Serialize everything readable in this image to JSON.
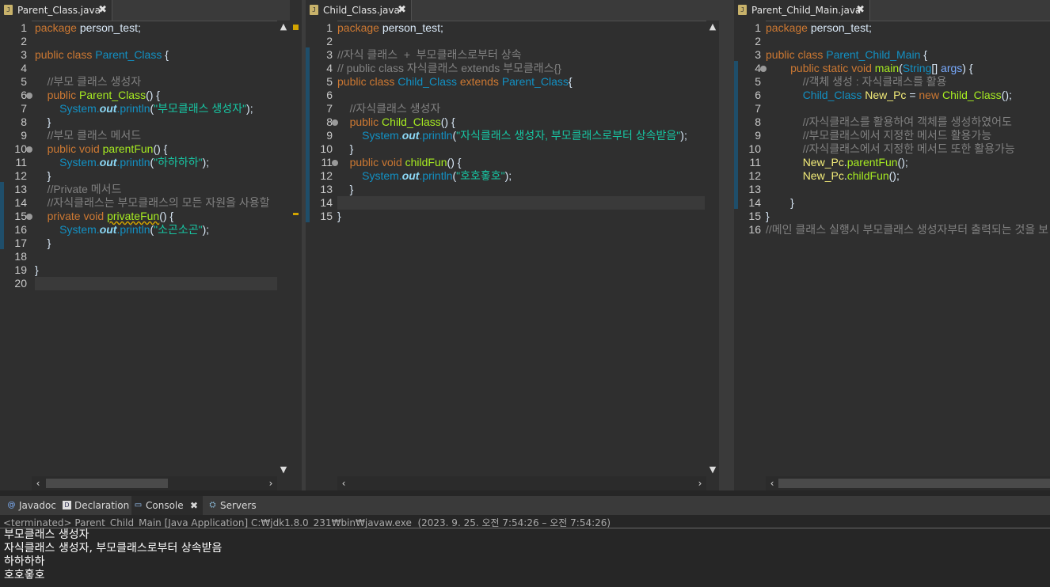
{
  "editors": [
    {
      "tab_label": "Parent_Class.java",
      "lines": [
        {
          "num": "1",
          "html": "<span class='kw'>package</span> <span class='pl'>person_test;</span>"
        },
        {
          "num": "2",
          "html": ""
        },
        {
          "num": "3",
          "html": "<span class='kw'>public</span> <span class='kw'>class</span> <span class='cls'>Parent_Class</span> <span class='pl'>{</span>"
        },
        {
          "num": "4",
          "html": ""
        },
        {
          "num": "5",
          "html": "    <span class='cmt'>//부모 클래스 생성자</span>"
        },
        {
          "num": "6",
          "html": "    <span class='kw'>public</span> <span class='mth'>Parent_Class</span><span class='pl'>() {</span>",
          "fold": true
        },
        {
          "num": "7",
          "html": "        <span class='cls'>System.</span><span class='fld'>out</span><span class='cls'>.println</span><span class='pl'>(</span><span class='str'>\"부모클래스 생성자\"</span><span class='pl'>);</span>"
        },
        {
          "num": "8",
          "html": "    <span class='pl'>}</span>"
        },
        {
          "num": "9",
          "html": "    <span class='cmt'>//부모 클래스 메서드</span>"
        },
        {
          "num": "10",
          "html": "    <span class='kw'>public</span> <span class='kw'>void</span> <span class='mth'>parentFun</span><span class='pl'>() {</span>",
          "fold": true
        },
        {
          "num": "11",
          "html": "        <span class='cls'>System.</span><span class='fld'>out</span><span class='cls'>.println</span><span class='pl'>(</span><span class='str'>\"하하하하\"</span><span class='pl'>);</span>"
        },
        {
          "num": "12",
          "html": "    <span class='pl'>}</span>"
        },
        {
          "num": "13",
          "html": "    <span class='cmt'>//Private 메서드</span>"
        },
        {
          "num": "14",
          "html": "    <span class='cmt'>//자식클래스는 부모클래스의 모든 자원을 사용할</span>"
        },
        {
          "num": "15",
          "html": "    <span class='kw'>private</span> <span class='kw'>void</span> <span class='mth' style='text-decoration:underline wavy #d2a400;'>privateFun</span><span class='pl'>() {</span>",
          "fold": true
        },
        {
          "num": "16",
          "html": "        <span class='cls'>System.</span><span class='fld'>out</span><span class='cls'>.println</span><span class='pl'>(</span><span class='str'>\"소곤소곤\"</span><span class='pl'>);</span>"
        },
        {
          "num": "17",
          "html": "    <span class='pl'>}</span>"
        },
        {
          "num": "18",
          "html": ""
        },
        {
          "num": "19",
          "html": "<span class='pl'>}</span>"
        },
        {
          "num": "20",
          "html": ""
        }
      ]
    },
    {
      "tab_label": "Child_Class.java",
      "lines": [
        {
          "num": "1",
          "html": "<span class='kw'>package</span> <span class='pl'>person_test;</span>"
        },
        {
          "num": "2",
          "html": ""
        },
        {
          "num": "3",
          "html": "<span class='cmt'>//자식 클래스  +  부모클래스로부터 상속</span>"
        },
        {
          "num": "4",
          "html": "<span class='cmt'>// public class 자식클래스 extends 부모클래스{}</span>"
        },
        {
          "num": "5",
          "html": "<span class='kw'>public</span> <span class='kw'>class</span> <span class='cls'>Child_Class</span> <span class='kw'>extends</span> <span class='cls'>Parent_Class</span><span class='pl'>{</span>"
        },
        {
          "num": "6",
          "html": ""
        },
        {
          "num": "7",
          "html": "    <span class='cmt'>//자식클래스 생성자</span>"
        },
        {
          "num": "8",
          "html": "    <span class='kw'>public</span> <span class='mth'>Child_Class</span><span class='pl'>() {</span>",
          "fold": true
        },
        {
          "num": "9",
          "html": "        <span class='cls'>System.</span><span class='fld'>out</span><span class='cls'>.println</span><span class='pl'>(</span><span class='str'>\"자식클래스 생성자, 부모클래스로부터 상속받음\"</span><span class='pl'>);</span>"
        },
        {
          "num": "10",
          "html": "    <span class='pl'>}</span>"
        },
        {
          "num": "11",
          "html": "    <span class='kw'>public</span> <span class='kw'>void</span> <span class='mth'>childFun</span><span class='pl'>() {</span>",
          "fold": true
        },
        {
          "num": "12",
          "html": "        <span class='cls'>System.</span><span class='fld'>out</span><span class='cls'>.println</span><span class='pl'>(</span><span class='str'>\"호호홓호\"</span><span class='pl'>);</span>"
        },
        {
          "num": "13",
          "html": "    <span class='pl'>}</span>"
        },
        {
          "num": "14",
          "html": ""
        },
        {
          "num": "15",
          "html": "<span class='pl'>}</span>"
        }
      ]
    },
    {
      "tab_label": "Parent_Child_Main.java",
      "lines": [
        {
          "num": "1",
          "html": "<span class='kw'>package</span> <span class='pl'>person_test;</span>"
        },
        {
          "num": "2",
          "html": ""
        },
        {
          "num": "3",
          "html": "<span class='kw'>public</span> <span class='kw'>class</span> <span class='cls'>Parent_Child_Main</span> <span class='pl'>{</span>"
        },
        {
          "num": "4",
          "html": "        <span class='kw'>public</span> <span class='kw'>static</span> <span class='kw'>void</span> <span class='mth'>main</span><span class='pl'>(</span><span class='cls'>String</span><span class='pl'>[]</span> <span class='prm'>args</span><span class='pl'>) {</span>",
          "fold": true
        },
        {
          "num": "5",
          "html": "            <span class='cmt'>//객체 생성 : 자식클래스를 활용</span>"
        },
        {
          "num": "6",
          "html": "            <span class='cls'>Child_Class</span> <span class='var'>New_Pc</span> <span class='pl'>=</span> <span class='kw'>new</span> <span class='mth'>Child_Class</span><span class='pl'>();</span>"
        },
        {
          "num": "7",
          "html": ""
        },
        {
          "num": "8",
          "html": "            <span class='cmt'>//자식클래스를 활용하여 객체를 생성하였어도</span>"
        },
        {
          "num": "9",
          "html": "            <span class='cmt'>//부모클래스에서 지정한 메서드 활용가능</span>"
        },
        {
          "num": "10",
          "html": "            <span class='cmt'>//자식클래스에서 지정한 메서드 또한 활용가능</span>"
        },
        {
          "num": "11",
          "html": "            <span class='var'>New_Pc</span><span class='pl'>.</span><span class='mth'>parentFun</span><span class='pl'>();</span>"
        },
        {
          "num": "12",
          "html": "            <span class='var'>New_Pc</span><span class='pl'>.</span><span class='mth'>childFun</span><span class='pl'>();</span>"
        },
        {
          "num": "13",
          "html": ""
        },
        {
          "num": "14",
          "html": "        <span class='pl'>}</span>"
        },
        {
          "num": "15",
          "html": "<span class='pl'>}</span>"
        },
        {
          "num": "16",
          "html": "<span class='cmt'>//메인 클래스 실행시 부모클래스 생성자부터 출력되는 것을 보</span>"
        }
      ]
    }
  ],
  "console": {
    "tabs": [
      {
        "label": "Javadoc",
        "icon": "@"
      },
      {
        "label": "Declaration",
        "icon": "D"
      },
      {
        "label": "Console",
        "icon": "▭",
        "close": "✖"
      },
      {
        "label": "Servers",
        "icon": "⛭"
      }
    ],
    "status": "<terminated> Parent_Child_Main [Java Application] C:₩jdk1.8.0_231₩bin₩javaw.exe  (2023. 9. 25. 오전 7:54:26 – 오전 7:54:26)",
    "output": [
      "부모클래스 생성자",
      "자식클래스 생성자, 부모클래스로부터 상속받음",
      "하하하하",
      "호호홓호"
    ]
  },
  "icons": {
    "tab_close": "✖",
    "java_file": "J",
    "scroll_up": "▲",
    "scroll_down": "▼",
    "scroll_left": "‹",
    "scroll_right": "›"
  },
  "colors": {
    "keyword": "#cc7832",
    "class": "#1290c3",
    "method": "#a7ec21",
    "string": "#17c6a3",
    "comment": "#808080",
    "field": "#8ddaf8"
  }
}
